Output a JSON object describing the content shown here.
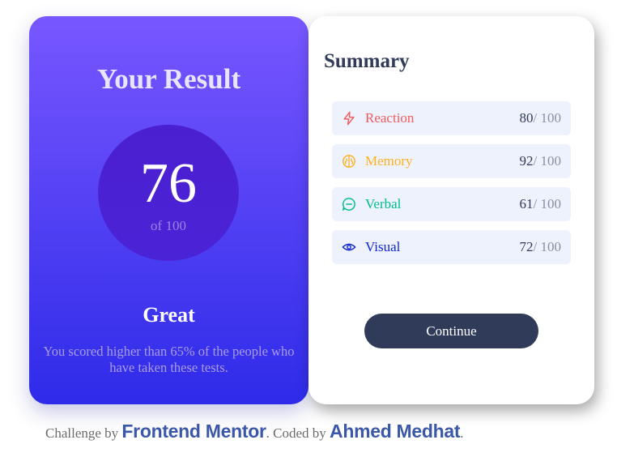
{
  "result": {
    "title": "Your Result",
    "score": "76",
    "score_max": "of 100",
    "rating": "Great",
    "description": "You scored higher than 65% of the people who have taken these tests."
  },
  "summary": {
    "title": "Summary",
    "items": [
      {
        "label": "Reaction",
        "score": "80",
        "max": "/ 100",
        "color": "#f25c5c",
        "icon": "lightning-icon"
      },
      {
        "label": "Memory",
        "score": "92",
        "max": "/ 100",
        "color": "#ffb01f",
        "icon": "brain-icon"
      },
      {
        "label": "Verbal",
        "score": "61",
        "max": "/ 100",
        "color": "#00bb8f",
        "icon": "chat-bubble-icon"
      },
      {
        "label": "Visual",
        "score": "72",
        "max": "/ 100",
        "color": "#1125d4",
        "icon": "eye-icon"
      }
    ],
    "continue_label": "Continue"
  },
  "footer": {
    "prefix": "Challenge by ",
    "link1": "Frontend Mentor",
    "middle": ". Coded by ",
    "link2": "Ahmed Medhat",
    "suffix": "."
  }
}
